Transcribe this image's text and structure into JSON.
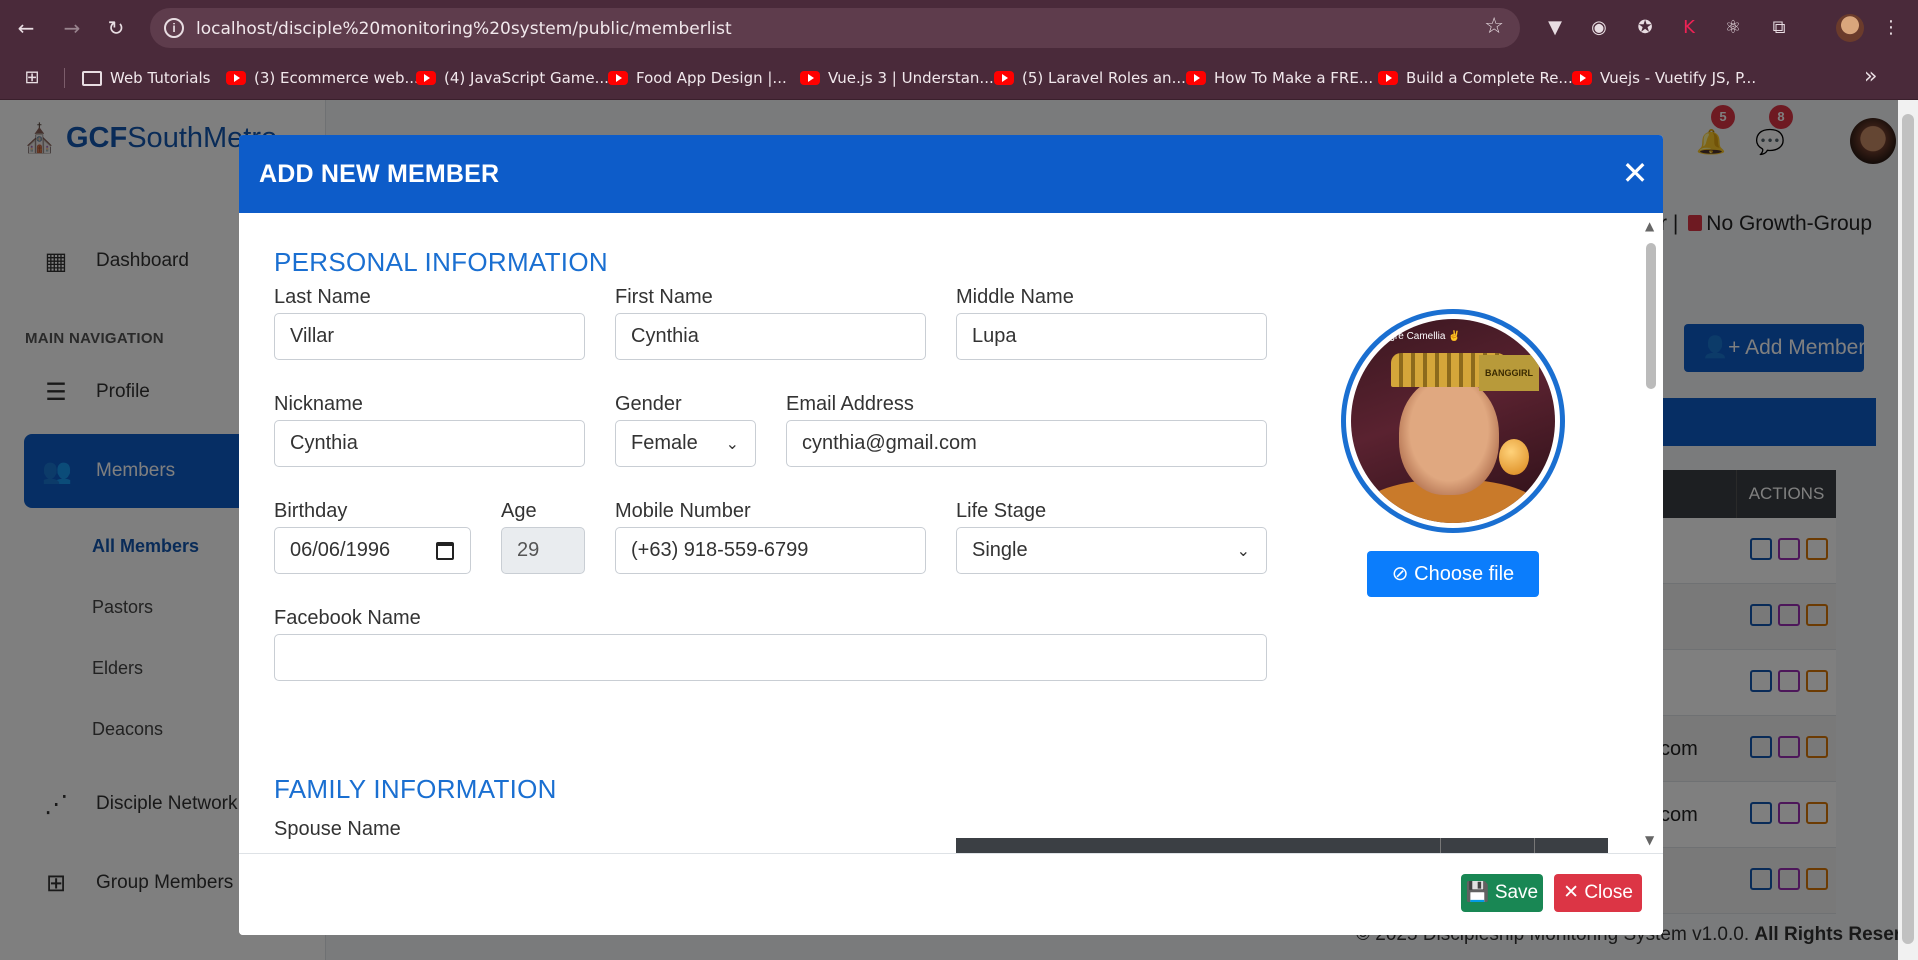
{
  "browser": {
    "url": "localhost/disciple%20monitoring%20system/public/memberlist",
    "bookmarks": [
      "Web Tutorials",
      "(3) Ecommerce web...",
      "(4) JavaScript Game...",
      "Food App Design |...",
      "Vue.js 3 | Understan...",
      "(5) Laravel Roles an...",
      "How To Make a FRE...",
      "Build a Complete Re...",
      "Vuejs - Vuetify JS, P..."
    ]
  },
  "sidebar": {
    "brand_bold": "GCF",
    "brand_rest": "SouthMetro",
    "dashboard": "Dashboard",
    "section_heading": "MAIN NAVIGATION",
    "profile": "Profile",
    "members": "Members",
    "sub_items": [
      "All Members",
      "Pastors",
      "Elders",
      "Deacons"
    ],
    "disciple_network": "Disciple Network",
    "group_members": "Group Members"
  },
  "header": {
    "notification_count": "5",
    "message_count": "8",
    "growth_group_prefix": "r |",
    "growth_group_text": "No Growth-Group",
    "add_member_label": "Add Member"
  },
  "table": {
    "actions_header": "ACTIONS",
    "row_email_fragments": [
      "",
      "",
      "",
      "com",
      "com",
      ""
    ]
  },
  "footer": {
    "copyright": "© 2025 Discipleship Monitoring System v1.0.0.",
    "rights": "All Rights Reserved."
  },
  "modal": {
    "title": "ADD NEW MEMBER",
    "personal_section": "PERSONAL INFORMATION",
    "family_section": "FAMILY INFORMATION",
    "labels": {
      "last_name": "Last Name",
      "first_name": "First Name",
      "middle_name": "Middle Name",
      "nickname": "Nickname",
      "gender": "Gender",
      "email": "Email Address",
      "birthday": "Birthday",
      "age": "Age",
      "mobile": "Mobile Number",
      "life_stage": "Life Stage",
      "facebook": "Facebook Name",
      "spouse": "Spouse Name"
    },
    "values": {
      "last_name": "Villar",
      "first_name": "Cynthia",
      "middle_name": "Lupa",
      "nickname": "Cynthia",
      "gender": "Female",
      "email": "cynthia@gmail.com",
      "birthday": "06/06/1996",
      "age": "29",
      "mobile": "(+63) 918-559-6799",
      "life_stage": "Single",
      "facebook": ""
    },
    "photo_caption": "...gre Camellia ✌",
    "photo_tag": "BANGGIRL",
    "choose_file_label": "Choose file",
    "save_label": "Save",
    "close_label": "Close"
  },
  "colors": {
    "primary": "#0d5cc9",
    "section_title": "#1a6fd1",
    "save": "#198754",
    "close": "#dc3545",
    "chrome": "#4a2a3a"
  }
}
